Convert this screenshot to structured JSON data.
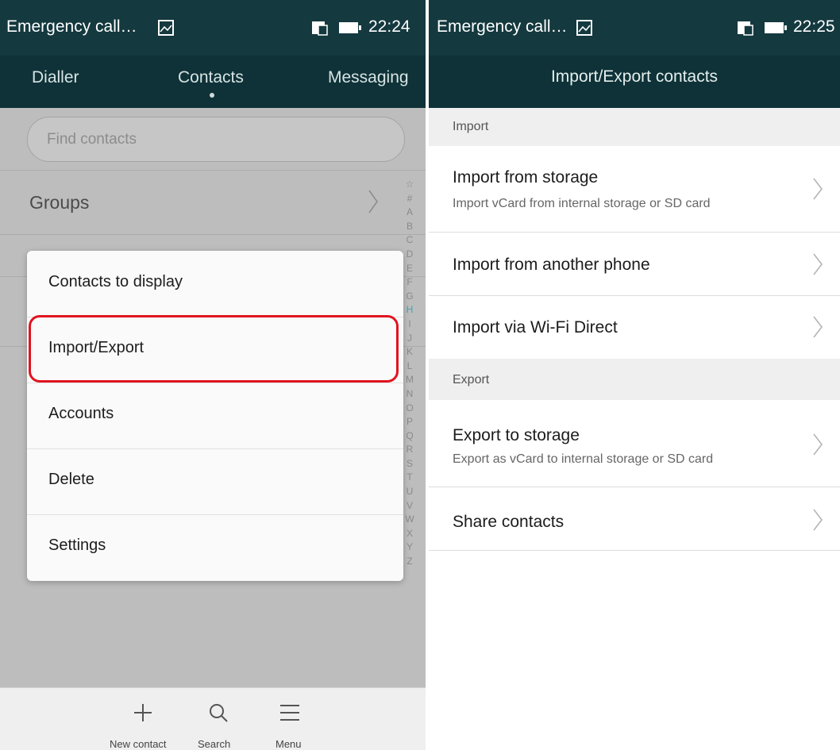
{
  "left": {
    "status": {
      "title": "Emergency call…",
      "time": "22:24"
    },
    "tabs": [
      "Dialler",
      "Contacts",
      "Messaging"
    ],
    "search": {
      "placeholder": "Find contacts"
    },
    "groups_label": "Groups",
    "alphabet": [
      "☆",
      "#",
      "A",
      "B",
      "C",
      "D",
      "E",
      "F",
      "G",
      "H",
      "I",
      "J",
      "K",
      "L",
      "M",
      "N",
      "O",
      "P",
      "Q",
      "R",
      "S",
      "T",
      "U",
      "V",
      "W",
      "X",
      "Y",
      "Z"
    ],
    "alphabet_active": "H",
    "menu": [
      "Contacts to display",
      "Import/Export",
      "Accounts",
      "Delete",
      "Settings"
    ],
    "bottom_bar": {
      "new_contact": "New contact",
      "search": "Search",
      "menu": "Menu"
    }
  },
  "right": {
    "status": {
      "title": "Emergency call…",
      "time": "22:25"
    },
    "title": "Import/Export contacts",
    "import_header": "Import",
    "import_items": [
      {
        "title": "Import from storage",
        "subtitle": "Import vCard from internal storage or SD card"
      },
      {
        "title": "Import from another phone"
      },
      {
        "title": "Import via Wi-Fi Direct"
      }
    ],
    "export_header": "Export",
    "export_items": [
      {
        "title": "Export to storage",
        "subtitle": "Export as vCard to internal storage or SD card"
      },
      {
        "title": "Share contacts"
      }
    ]
  },
  "colors": {
    "status_bar": "#14393f",
    "header": "#0e3237",
    "highlight": "#e1141f",
    "active_letter": "#3ba6b9"
  },
  "icons": [
    "image-icon",
    "sim-icon",
    "battery-icon",
    "chevron-right-icon",
    "plus-icon",
    "search-icon",
    "menu-icon"
  ]
}
